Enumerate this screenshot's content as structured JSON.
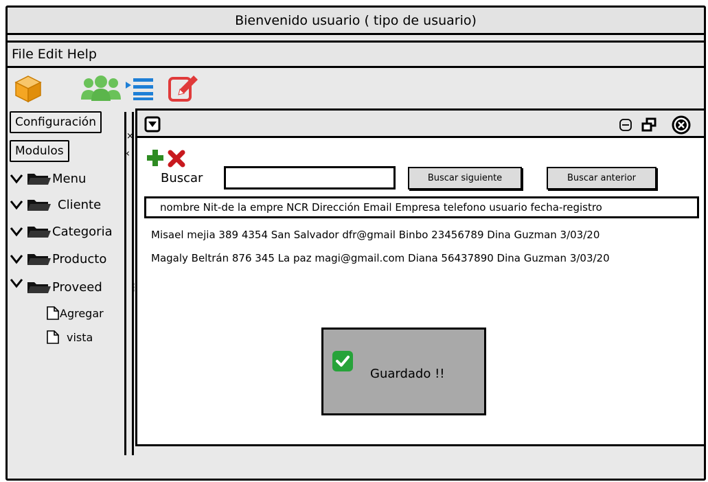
{
  "window": {
    "title": "Bienvenido usuario ( tipo de usuario)"
  },
  "menu": {
    "items": [
      "File",
      "Edit",
      "Help"
    ]
  },
  "toolbar": {
    "icons": [
      "cube-icon",
      "users-icon",
      "list-icon",
      "edit-icon"
    ],
    "colors": {
      "cube": "#F5A623",
      "users": "#6AC259",
      "list": "#1E7FD6",
      "edit": "#E03A3A"
    }
  },
  "sidebar": {
    "config_label": "Configuración",
    "modulos_label": "Modulos",
    "items": [
      {
        "label": "Menu"
      },
      {
        "label": "Cliente"
      },
      {
        "label": "Categoria"
      },
      {
        "label": "Producto"
      },
      {
        "label": "Proveed"
      }
    ],
    "subitems": [
      {
        "label": "Agregar"
      },
      {
        "label": "vista"
      }
    ]
  },
  "actions": {
    "add_color": "#2E8B22",
    "delete_color": "#C8191E"
  },
  "search": {
    "label": "Buscar",
    "value": "",
    "next_label": "Buscar siguiente",
    "prev_label": "Buscar anterior"
  },
  "table": {
    "header": "nombre  Nit-de la empre NCR Dirección  Email Empresa telefono usuario fecha-registro",
    "rows": [
      "Misael mejia 389 4354 San Salvador dfr@gmail Binbo 23456789 Dina Guzman 3/03/20",
      "Magaly Beltrán 876 345 La paz magi@gmail.com Diana 56437890 Dina Guzman 3/03/20"
    ]
  },
  "dialog": {
    "message": "Guardado !!",
    "check_color": "#27A33A"
  }
}
